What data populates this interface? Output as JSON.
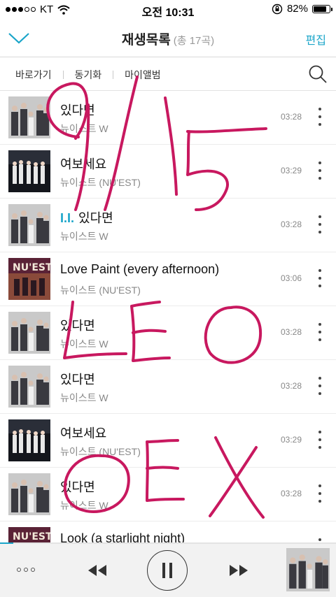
{
  "status_bar": {
    "carrier": "KT",
    "time": "오전 10:31",
    "battery": "82%",
    "battery_level": 0.82,
    "icons": [
      "signal-dots-icon",
      "wifi-icon",
      "orientation-lock-icon",
      "battery-icon"
    ]
  },
  "header": {
    "title": "재생목록",
    "count": "(총 17곡)",
    "edit_label": "편집",
    "collapse_icon": "chevron-down-icon",
    "accent": "#1aa5c9"
  },
  "subnav": {
    "items": [
      "바로가기",
      "동기화",
      "마이앨범"
    ],
    "search_icon": "search-icon"
  },
  "tracks": [
    {
      "tag": "",
      "title": "있다면",
      "artist": "뉴이스트 W",
      "duration": "03:28",
      "art": "gray"
    },
    {
      "tag": "",
      "title": "여보세요",
      "artist": "뉴이스트 (NU'EST)",
      "duration": "03:29",
      "art": "dark"
    },
    {
      "tag": "I.I.",
      "title": "있다면",
      "artist": "뉴이스트 W",
      "duration": "03:28",
      "art": "gray"
    },
    {
      "tag": "",
      "title": "Love Paint (every afternoon)",
      "artist": "뉴이스트 (NU'EST)",
      "duration": "03:06",
      "art": "nuest"
    },
    {
      "tag": "",
      "title": "있다면",
      "artist": "뉴이스트 W",
      "duration": "03:28",
      "art": "gray"
    },
    {
      "tag": "",
      "title": "있다면",
      "artist": "뉴이스트 W",
      "duration": "03:28",
      "art": "gray"
    },
    {
      "tag": "",
      "title": "여보세요",
      "artist": "뉴이스트 (NU'EST)",
      "duration": "03:29",
      "art": "dark"
    },
    {
      "tag": "",
      "title": "있다면",
      "artist": "뉴이스트 W",
      "duration": "03:28",
      "art": "gray"
    },
    {
      "tag": "",
      "title": "Look (a starlight night)",
      "artist": "",
      "duration": "",
      "art": "nuest"
    }
  ],
  "player": {
    "progress": 0.04,
    "more_icon": "more-dots-icon",
    "prev_icon": "rewind-icon",
    "pause_icon": "pause-icon",
    "next_icon": "fast-forward-icon"
  },
  "scribble": {
    "text_lines": [
      "9/15",
      "LEO",
      "OEX"
    ],
    "color": "#c8185f"
  }
}
